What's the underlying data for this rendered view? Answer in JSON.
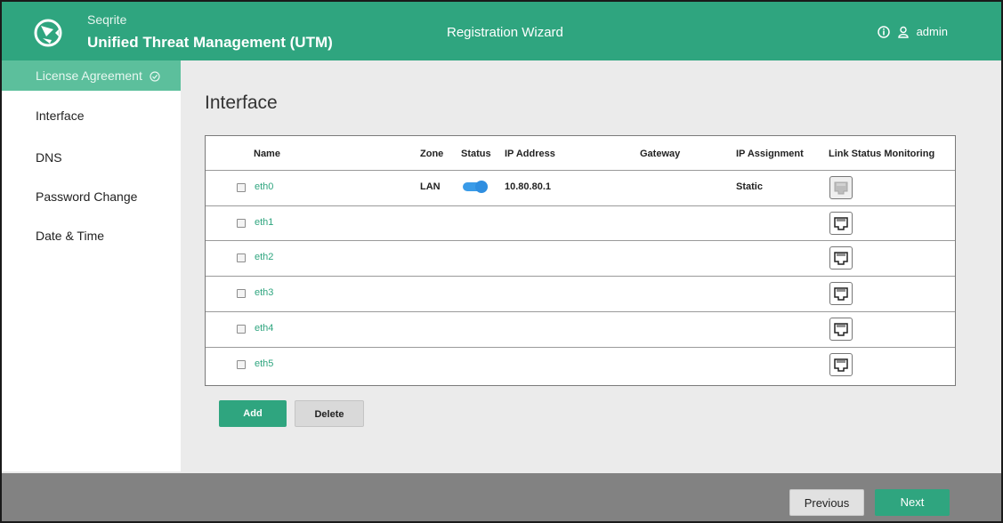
{
  "header": {
    "brand_small": "Seqrite",
    "brand_big": "Unified Threat Management (UTM)",
    "wizard_title": "Registration Wizard",
    "user": "admin",
    "logo_icon": "globe-logo-icon",
    "info_icon": "info-icon",
    "user_icon": "user-icon"
  },
  "sidebar": {
    "items": [
      {
        "label": "License Agreement",
        "state": "completed"
      },
      {
        "label": "Interface",
        "state": "current"
      },
      {
        "label": "DNS",
        "state": "pending"
      },
      {
        "label": "Password Change",
        "state": "pending"
      },
      {
        "label": "Date & Time",
        "state": "pending"
      }
    ]
  },
  "main": {
    "title": "Interface",
    "table": {
      "columns": [
        "Name",
        "Zone",
        "Status",
        "IP Address",
        "Gateway",
        "IP Assignment",
        "Link Status Monitoring"
      ],
      "rows": [
        {
          "name": "eth0",
          "zone": "LAN",
          "status": "on",
          "ip": "10.80.80.1",
          "gateway": "",
          "assignment": "Static",
          "link": "connected"
        },
        {
          "name": "eth1",
          "zone": "",
          "status": "",
          "ip": "",
          "gateway": "",
          "assignment": "",
          "link": "disconnected"
        },
        {
          "name": "eth2",
          "zone": "",
          "status": "",
          "ip": "",
          "gateway": "",
          "assignment": "",
          "link": "disconnected"
        },
        {
          "name": "eth3",
          "zone": "",
          "status": "",
          "ip": "",
          "gateway": "",
          "assignment": "",
          "link": "disconnected"
        },
        {
          "name": "eth4",
          "zone": "",
          "status": "",
          "ip": "",
          "gateway": "",
          "assignment": "",
          "link": "disconnected"
        },
        {
          "name": "eth5",
          "zone": "",
          "status": "",
          "ip": "",
          "gateway": "",
          "assignment": "",
          "link": "disconnected"
        }
      ]
    },
    "add_label": "Add",
    "delete_label": "Delete"
  },
  "footer": {
    "previous_label": "Previous",
    "next_label": "Next"
  },
  "colors": {
    "brand": "#2fa57f",
    "sidebar_active": "#5cbf9c",
    "toggle_on": "#3a9be8",
    "footer": "#828282"
  }
}
